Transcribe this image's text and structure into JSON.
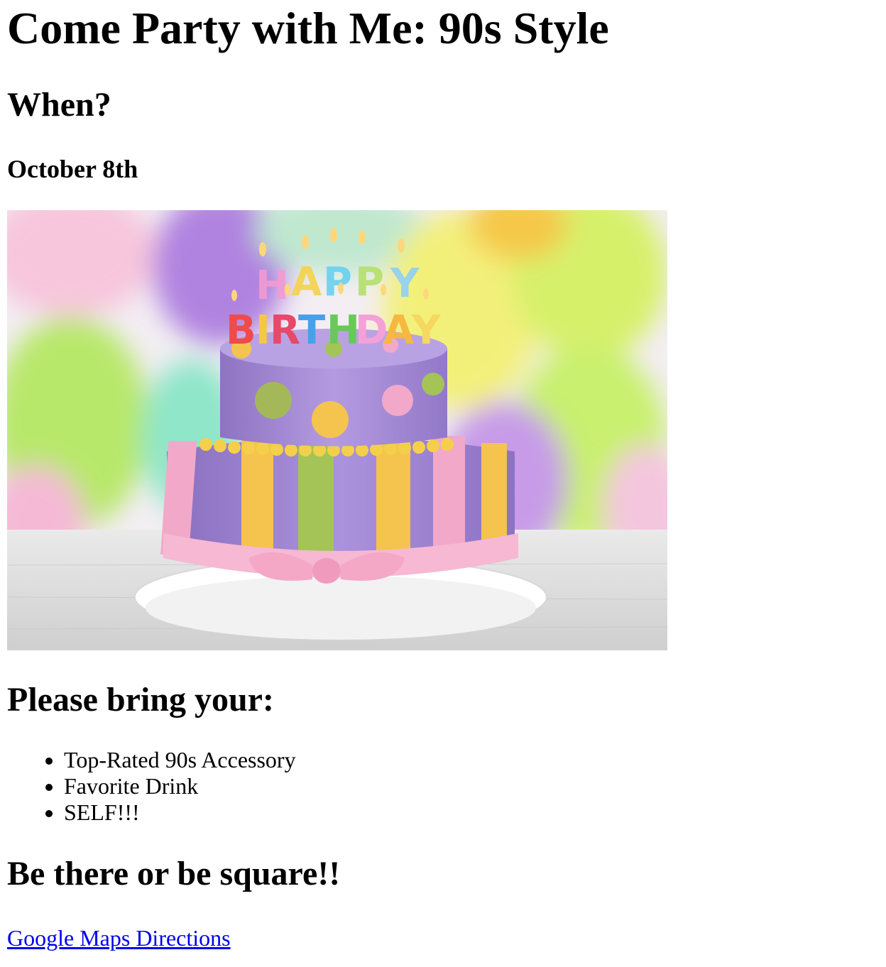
{
  "page": {
    "title": "Come Party with Me: 90s Style",
    "when_heading": "When?",
    "date": "October 8th",
    "image_alt": "Happy birthday cake with colorful balloons",
    "bring_heading": "Please bring your:",
    "bring_items": [
      "Top-Rated 90s Accessory",
      "Favorite Drink",
      "SELF!!!"
    ],
    "closing": "Be there or be square!!",
    "directions_link": "Google Maps Directions"
  },
  "colors": {
    "text": "#000000",
    "link": "#0000ee",
    "background": "#ffffff"
  }
}
